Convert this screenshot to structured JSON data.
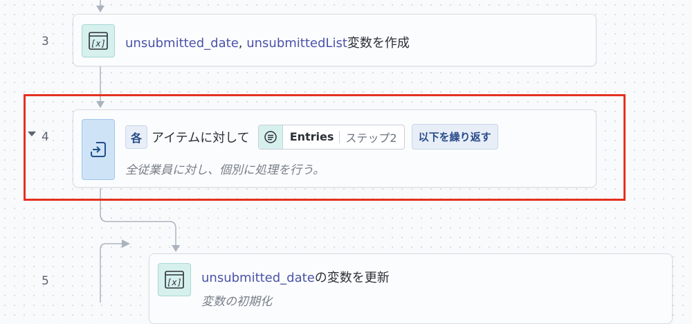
{
  "steps": [
    {
      "number": "3",
      "title_parts": [
        "unsubmitted_date",
        ", ",
        "unsubmittedList",
        "変数を作成"
      ],
      "icon": "variable-icon"
    },
    {
      "number": "4",
      "each_badge": "各",
      "title_text": "アイテムに対して",
      "entries_pill": {
        "name": "Entries",
        "step": "ステップ2",
        "icon": "list-icon"
      },
      "repeat_button": "以下を繰り返す",
      "description": "全従業員に対し、個別に処理を行う。",
      "icon": "loop-icon"
    },
    {
      "number": "5",
      "title_parts": [
        "unsubmitted_date",
        "の変数を更新"
      ],
      "description": "変数の初期化",
      "icon": "variable-icon"
    }
  ],
  "colors": {
    "highlight": "#e5301f",
    "variable_link": "#4a52a8",
    "badge_text": "#294a88"
  }
}
